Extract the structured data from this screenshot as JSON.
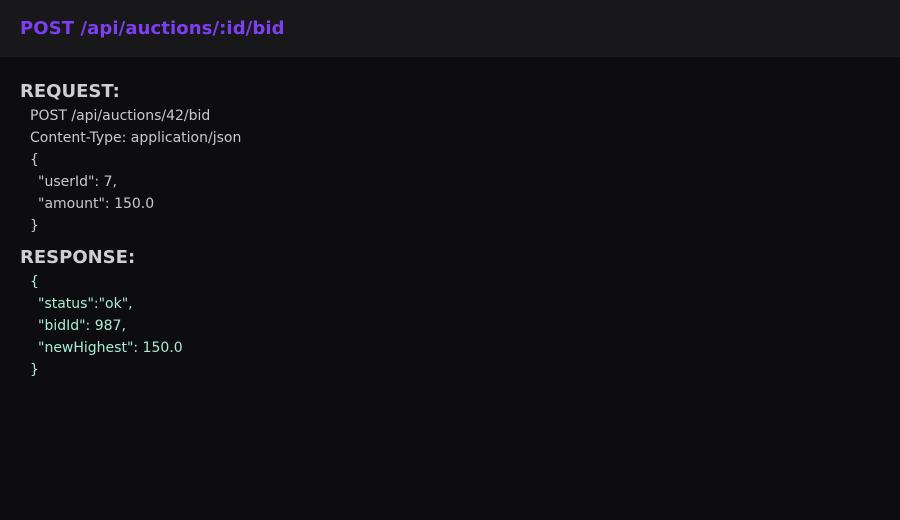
{
  "header": {
    "title": "POST /api/auctions/:id/bid"
  },
  "request": {
    "heading": "REQUEST:",
    "lines": [
      "POST /api/auctions/42/bid",
      "Content-Type: application/json",
      "{",
      "\"userId\": 7,",
      "\"amount\": 150.0",
      "}"
    ]
  },
  "response": {
    "heading": "RESPONSE:",
    "lines": [
      "{",
      "\"status\":\"ok\",",
      "\"bidId\": 987,",
      "\"newHighest\": 150.0",
      "}"
    ]
  },
  "colors": {
    "title": "#7e3ff2",
    "heading": "#cfcfcf",
    "request_text": "#c9c9c9",
    "response_text": "#a8ecd2",
    "background": "#0d0d0f",
    "header_background": "#18181a"
  }
}
